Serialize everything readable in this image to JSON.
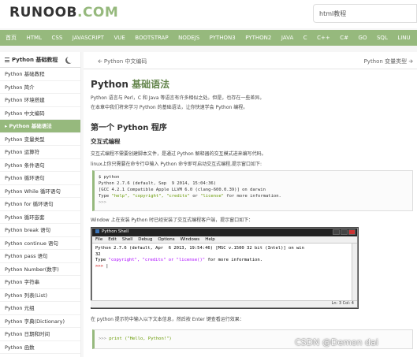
{
  "header": {
    "logo_main": "RUNOOB",
    "logo_dot": ".",
    "logo_tld": "COM",
    "search_value": "html教程"
  },
  "nav": [
    "首页",
    "HTML",
    "CSS",
    "JAVASCRIPT",
    "VUE",
    "BOOTSTRAP",
    "NODEJS",
    "PYTHON3",
    "PYTHON2",
    "JAVA",
    "C",
    "C++",
    "C#",
    "GO",
    "SQL",
    "LINU"
  ],
  "sidebar": {
    "heading": "Python 基础教程",
    "items": [
      {
        "label": "Python 基础教程"
      },
      {
        "label": "Python 简介"
      },
      {
        "label": "Python 环境搭建"
      },
      {
        "label": "Python 中文编码"
      },
      {
        "label": "Python 基础语法",
        "active": true
      },
      {
        "label": "Python 变量类型"
      },
      {
        "label": "Python 运算符"
      },
      {
        "label": "Python 条件语句"
      },
      {
        "label": "Python 循环语句"
      },
      {
        "label": "Python While 循环语句"
      },
      {
        "label": "Python for 循环语句"
      },
      {
        "label": "Python 循环嵌套"
      },
      {
        "label": "Python break 语句"
      },
      {
        "label": "Python continue 语句"
      },
      {
        "label": "Python pass 语句"
      },
      {
        "label": "Python Number(数字)"
      },
      {
        "label": "Python 字符串"
      },
      {
        "label": "Python 列表(List)"
      },
      {
        "label": "Python 元组"
      },
      {
        "label": "Python 字典(Dictionary)"
      },
      {
        "label": "Python 日期和时间"
      },
      {
        "label": "Python 函数"
      }
    ]
  },
  "pager": {
    "prev": "Python 中文编码",
    "next": "Python 变量类型"
  },
  "article": {
    "title_a": "Python",
    "title_b": "基础语法",
    "intro1": "Python 语言与 Perl，C 和 Java 等语言有许多相似之处。但是，也存在一些差异。",
    "intro2": "在本章中我们将来学习 Python 的基础语法，让你快速学会 Python 编程。",
    "h2": "第一个 Python 程序",
    "h3": "交互式编程",
    "para1": "交互式编程不需要创建脚本文件，是通过 Python 解释器的交互模式进来编写代码。",
    "para2": "linux上你只需要在命令行中输入 Python 命令即可启动交互式编程,提示窗口如下:",
    "code1": {
      "l1": "$ python",
      "l2": "Python 2.7.6 (default, Sep  9 2014, 15:04:36)",
      "l3": "[GCC 4.2.1 Compatible Apple LLVM 6.0 (clang-600.0.39)] on darwin",
      "l4a": "Type ",
      "l4b": "\"help\", \"copyright\", \"credits\"",
      "l4c": " or ",
      "l4d": "\"license\"",
      "l4e": " for more information.",
      "l5": ">>>"
    },
    "para3": "Window 上在安装 Python 时已经安装了交互式编程客户端，提示窗口如下：",
    "shell": {
      "title": "Python Shell",
      "menu": [
        "File",
        "Edit",
        "Shell",
        "Debug",
        "Options",
        "Windows",
        "Help"
      ],
      "line1": "Python 2.7.6 (default, Apr  6 2013, 19:54:46) [MSC v.1500 32 bit (Intel)] on win",
      "line2": "32",
      "line3a": "Type ",
      "line3b": "\"copyright\", \"credits\" or \"license()\"",
      "line3c": " for more information.",
      "prompt": ">>> ",
      "status": "Ln: 3 Col: 4"
    },
    "para4": "在 python 提示符中输入以下文本信息，然后按 Enter 键查看运行效果：",
    "code2": {
      "prompt": ">>> ",
      "kw": "print",
      "rest": " (\"Hello, Python!\")"
    }
  },
  "watermark": "CSDN @Demon dai",
  "colors": {
    "accent": "#96b97d",
    "title_green": "#64854c"
  }
}
